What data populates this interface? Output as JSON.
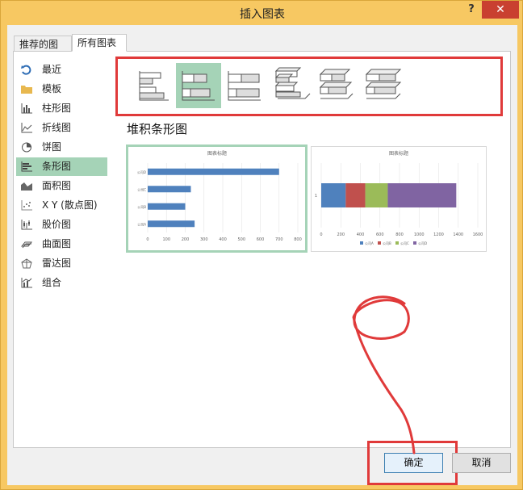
{
  "window": {
    "title": "插入图表",
    "help_label": "?",
    "close_label": "✕"
  },
  "tabs": [
    {
      "label": "推荐的图表"
    },
    {
      "label": "所有图表"
    }
  ],
  "sidebar": {
    "items": [
      {
        "label": "最近",
        "icon": "recent-icon"
      },
      {
        "label": "模板",
        "icon": "folder-icon"
      },
      {
        "label": "柱形图",
        "icon": "column-chart-icon"
      },
      {
        "label": "折线图",
        "icon": "line-chart-icon"
      },
      {
        "label": "饼图",
        "icon": "pie-chart-icon"
      },
      {
        "label": "条形图",
        "icon": "bar-chart-icon",
        "selected": true
      },
      {
        "label": "面积图",
        "icon": "area-chart-icon"
      },
      {
        "label": "X Y (散点图)",
        "icon": "scatter-chart-icon"
      },
      {
        "label": "股价图",
        "icon": "stock-chart-icon"
      },
      {
        "label": "曲面图",
        "icon": "surface-chart-icon"
      },
      {
        "label": "雷达图",
        "icon": "radar-chart-icon"
      },
      {
        "label": "组合",
        "icon": "combo-chart-icon"
      }
    ]
  },
  "subtypes": {
    "selected_index": 1,
    "items": [
      {
        "icon": "clustered-bar-icon"
      },
      {
        "icon": "stacked-bar-icon"
      },
      {
        "icon": "100-stacked-bar-icon"
      },
      {
        "icon": "3d-clustered-bar-icon"
      },
      {
        "icon": "3d-stacked-bar-icon"
      },
      {
        "icon": "3d-100-stacked-bar-icon"
      }
    ]
  },
  "section_title": "堆积条形图",
  "previews": [
    {
      "title": "图表标题",
      "selected": true,
      "chart_data": {
        "type": "bar",
        "categories": [
          "公司A",
          "公司B",
          "公司C",
          "公司D"
        ],
        "values": [
          250,
          200,
          230,
          700
        ],
        "xticks": [
          "0",
          "100",
          "200",
          "300",
          "400",
          "500",
          "600",
          "700",
          "800"
        ],
        "xlim": [
          0,
          800
        ]
      }
    },
    {
      "title": "图表标题",
      "selected": false,
      "chart_data": {
        "type": "bar",
        "categories": [
          "1"
        ],
        "series": [
          {
            "name": "公司A",
            "values": [
              250
            ]
          },
          {
            "name": "公司B",
            "values": [
              200
            ]
          },
          {
            "name": "公司C",
            "values": [
              230
            ]
          },
          {
            "name": "公司D",
            "values": [
              700
            ]
          }
        ],
        "xticks": [
          "0",
          "200",
          "400",
          "600",
          "800",
          "1000",
          "1200",
          "1400",
          "1600"
        ],
        "xlim": [
          0,
          1600
        ],
        "legend_position": "bottom"
      }
    }
  ],
  "colors": {
    "series": [
      "#4f81bd",
      "#c0504d",
      "#9bbb59",
      "#8064a2"
    ],
    "selected_bg": "#a5d3b7",
    "annotation": "#e03a3a"
  },
  "buttons": {
    "ok": "确定",
    "cancel": "取消"
  }
}
